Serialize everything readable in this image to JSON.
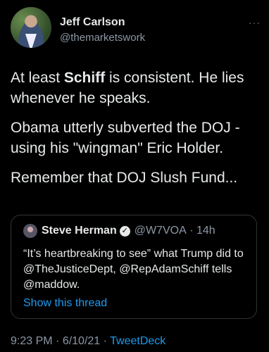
{
  "author": {
    "name": "Jeff Carlson",
    "handle": "@themarketswork"
  },
  "more_menu": "···",
  "tweet": {
    "p1_bold": "Schiff",
    "p1_before": "At least ",
    "p1_after": " is consistent. He lies whenever he speaks.",
    "p2": "Obama utterly subverted the DOJ - using his \"wingman\" Eric Holder.",
    "p3": "Remember that DOJ Slush Fund..."
  },
  "quoted": {
    "name": "Steve Herman",
    "verified": "✓",
    "handle": "@W7VOA",
    "separator": " · ",
    "time": "14h",
    "text": "“It’s heartbreaking to see” what Trump did to @TheJusticeDept, @RepAdamSchiff tells @maddow.",
    "show_thread": "Show this thread"
  },
  "footer": {
    "time": "9:23 PM",
    "sep1": " · ",
    "date": "6/10/21",
    "sep2": " · ",
    "client": "TweetDeck"
  }
}
